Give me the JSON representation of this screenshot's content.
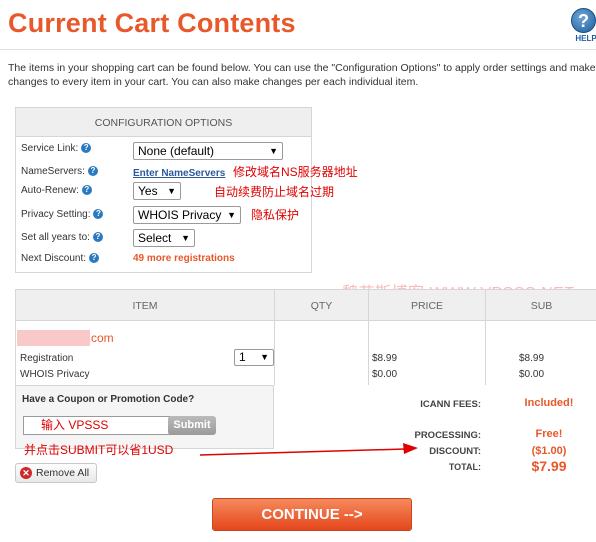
{
  "page": {
    "title": "Current Cart Contents",
    "help_label": "HELP",
    "help_glyph": "?"
  },
  "intro": "The items in your shopping cart can be found below. You can use the \"Configuration Options\" to apply order settings and make changes to every item in your cart. You can also make changes per each individual item.",
  "config": {
    "heading": "CONFIGURATION OPTIONS",
    "service_link": {
      "label": "Service Link:",
      "value": "None (default)"
    },
    "nameservers": {
      "label": "NameServers:",
      "link": "Enter NameServers"
    },
    "auto_renew": {
      "label": "Auto-Renew:",
      "value": "Yes"
    },
    "privacy": {
      "label": "Privacy Setting:",
      "value": "WHOIS Privacy"
    },
    "all_years": {
      "label": "Set all years to:",
      "value": "Select"
    },
    "next_discount": {
      "label": "Next Discount:",
      "value": "49 more registrations"
    }
  },
  "annotations": {
    "ns": "修改域名NS服务器地址",
    "renew": "自动续费防止域名过期",
    "privacy": "隐私保护",
    "watermark": "魏艾斯博客 WWW.VPSSS.NET",
    "coupon": "并点击SUBMIT可以省1USD"
  },
  "table": {
    "headers": {
      "item": "ITEM",
      "qty": "QTY",
      "price": "PRICE",
      "sub": "SUB"
    },
    "domain_suffix": "com",
    "rows": [
      {
        "item": "Registration",
        "qty": "1",
        "price": "$8.99",
        "sub": "$8.99"
      },
      {
        "item": "WHOIS Privacy",
        "price": "$0.00",
        "sub": "$0.00"
      }
    ]
  },
  "coupon": {
    "title": "Have a Coupon or Promotion Code?",
    "value": "输入 VPSSS",
    "submit": "Submit"
  },
  "remove_all": "Remove All",
  "totals": {
    "icann_label": "ICANN FEES:",
    "icann_value": "Included!",
    "processing_label": "PROCESSING:",
    "processing_value": "Free!",
    "discount_label": "DISCOUNT:",
    "discount_value": "($1.00)",
    "total_label": "TOTAL:",
    "total_value": "$7.99"
  },
  "continue": "CONTINUE -->",
  "colors": {
    "accent": "#e8582a",
    "annotation": "#e00000",
    "link": "#2a5a9e"
  }
}
